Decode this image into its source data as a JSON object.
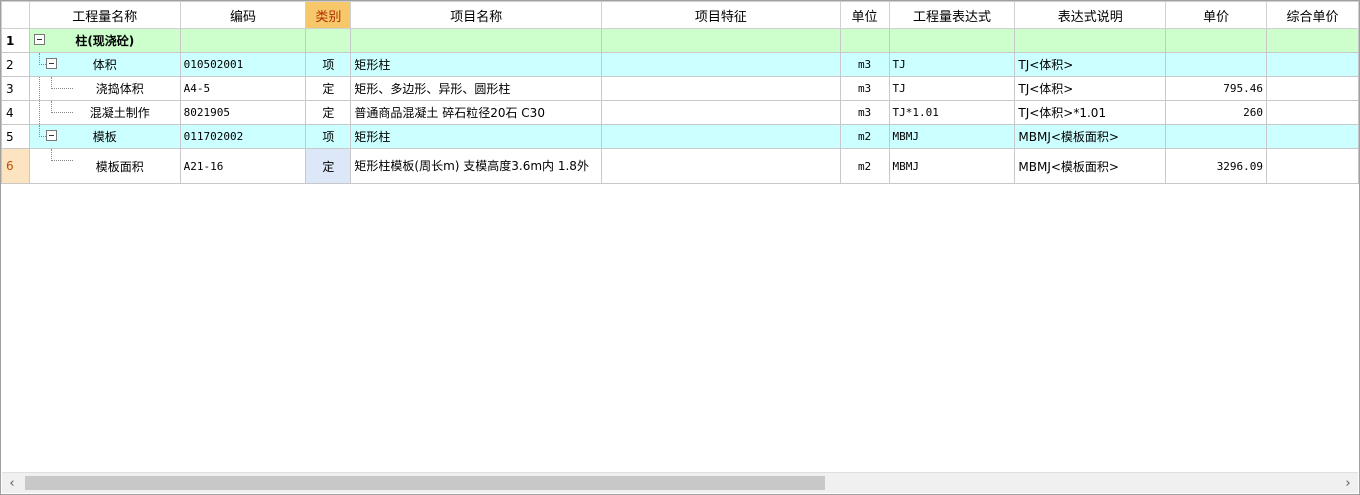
{
  "headers": {
    "rownum": "",
    "name": "工程量名称",
    "code": "编码",
    "category": "类别",
    "item_name": "项目名称",
    "item_feature": "项目特征",
    "unit": "单位",
    "qty_expr": "工程量表达式",
    "expr_desc": "表达式说明",
    "unit_price": "单价",
    "composite_price": "综合单价"
  },
  "rows": [
    {
      "num": "1",
      "name": "柱(现浇砼)",
      "code": "",
      "category": "",
      "item_name": "",
      "item_feature": "",
      "unit": "",
      "qty_expr": "",
      "expr_desc": "",
      "unit_price": "",
      "composite_price": ""
    },
    {
      "num": "2",
      "name": "体积",
      "code": "010502001",
      "category": "项",
      "item_name": "矩形柱",
      "item_feature": "",
      "unit": "m3",
      "qty_expr": "TJ",
      "expr_desc": "TJ<体积>",
      "unit_price": "",
      "composite_price": ""
    },
    {
      "num": "3",
      "name": "浇捣体积",
      "code": "A4-5",
      "category": "定",
      "item_name": "矩形、多边形、异形、圆形柱",
      "item_feature": "",
      "unit": "m3",
      "qty_expr": "TJ",
      "expr_desc": "TJ<体积>",
      "unit_price": "795.46",
      "composite_price": ""
    },
    {
      "num": "4",
      "name": "混凝土制作",
      "code": "8021905",
      "category": "定",
      "item_name": "普通商品混凝土 碎石粒径20石 C30",
      "item_feature": "",
      "unit": "m3",
      "qty_expr": "TJ*1.01",
      "expr_desc": "TJ<体积>*1.01",
      "unit_price": "260",
      "composite_price": ""
    },
    {
      "num": "5",
      "name": "模板",
      "code": "011702002",
      "category": "项",
      "item_name": "矩形柱",
      "item_feature": "",
      "unit": "m2",
      "qty_expr": "MBMJ",
      "expr_desc": "MBMJ<模板面积>",
      "unit_price": "",
      "composite_price": ""
    },
    {
      "num": "6",
      "name": "模板面积",
      "code": "A21-16",
      "category": "定",
      "item_name": "矩形柱模板(周长m) 支模高度3.6m内 1.8外",
      "item_feature": "",
      "unit": "m2",
      "qty_expr": "MBMJ",
      "expr_desc": "MBMJ<模板面积>",
      "unit_price": "3296.09",
      "composite_price": ""
    }
  ],
  "scrollbar": {
    "left_icon": "‹",
    "right_icon": "›"
  }
}
